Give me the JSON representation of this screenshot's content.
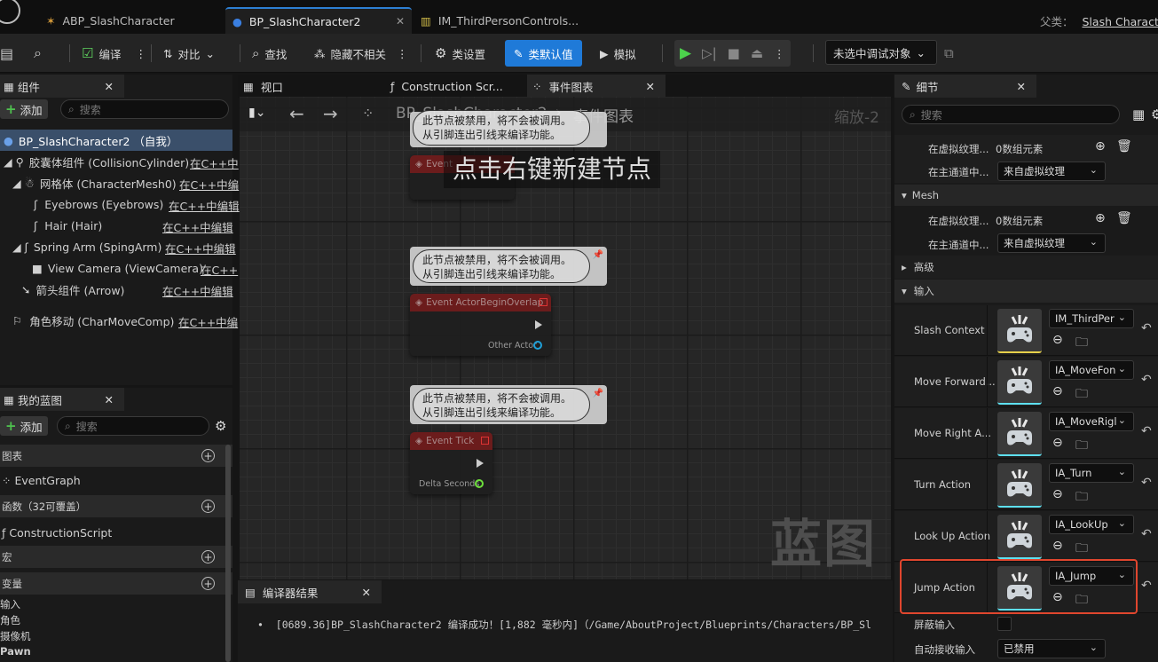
{
  "tabs": [
    {
      "label": "ABP_SlashCharacter",
      "icon": "anim-blueprint-icon"
    },
    {
      "label": "BP_SlashCharacter2",
      "icon": "character-blueprint-icon"
    },
    {
      "label": "IM_ThirdPersonControls...",
      "icon": "input-mapping-icon"
    }
  ],
  "parent_class": {
    "label": "父类：",
    "value": "Slash Character"
  },
  "toolbar": {
    "compile": "编译",
    "diff": "对比",
    "find": "查找",
    "hide_unrelated": "隐藏不相关",
    "class_settings": "类设置",
    "class_defaults": "类默认值",
    "simulate": "模拟",
    "debug_target": "未选中调试对象"
  },
  "components_panel": {
    "title": "组件",
    "add": "添加",
    "search_placeholder": "搜索",
    "root": "BP_SlashCharacter2 （自我）",
    "items": [
      {
        "label": "胶囊体组件 (CollisionCylinder)",
        "link": "在C++中"
      },
      {
        "label": "网格体 (CharacterMesh0)",
        "link": "在C++中编"
      },
      {
        "label": "Eyebrows (Eyebrows)",
        "link": "在C++中编辑"
      },
      {
        "label": "Hair (Hair)",
        "link": "在C++中编辑"
      },
      {
        "label": "Spring Arm (SpingArm)",
        "link": "在C++中编辑"
      },
      {
        "label": "View Camera (ViewCamera)",
        "link": "在C++"
      },
      {
        "label": "箭头组件 (Arrow)",
        "link": "在C++中编辑"
      },
      {
        "label": "角色移动 (CharMoveComp)",
        "link": "在C++中编"
      }
    ]
  },
  "my_blueprint": {
    "title": "我的蓝图",
    "add": "添加",
    "search_placeholder": "搜索",
    "graphs_header": "图表",
    "event_graph": "EventGraph",
    "functions_header": "函数（32可覆盖）",
    "construction_script": "ConstructionScript",
    "macros_header": "宏",
    "variables_header": "变量",
    "variable_categories": [
      "输入",
      "角色",
      "摄像机",
      "Pawn"
    ]
  },
  "graph_tabs": [
    {
      "label": "视口"
    },
    {
      "label": "Construction Scr..."
    },
    {
      "label": "事件图表"
    }
  ],
  "graph": {
    "breadcrumb_root": "BP_SlashCharacter2",
    "breadcrumb_current": "事件图表",
    "zoom": "缩放-2",
    "hint": "点击右键新建节点",
    "watermark": "蓝图",
    "disabled_comment": "此节点被禁用，将不会被调用。\n从引脚连出引线来编译功能。",
    "nodes": [
      {
        "title": "Event ActorBeginOverlap",
        "pin": "Other Actor"
      },
      {
        "title": "Event Tick",
        "pin": "Delta Seconds"
      },
      {
        "title": "Event",
        "pin": ""
      }
    ]
  },
  "compiler": {
    "title": "编译器结果",
    "message": "[0689.36]BP_SlashCharacter2 编译成功！[1,882 毫秒内]（/Game/AboutProject/Blueprints/Characters/BP_Sl"
  },
  "details": {
    "title": "细节",
    "search_placeholder": "搜索",
    "rows_top": [
      {
        "label": "在虚拟纹理...",
        "value": "0数组元素"
      },
      {
        "label": "在主通道中...",
        "value": "来自虚拟纹理"
      }
    ],
    "mesh_header": "Mesh",
    "rows_mesh": [
      {
        "label": "在虚拟纹理...",
        "value": "0数组元素"
      },
      {
        "label": "在主通道中...",
        "value": "来自虚拟纹理"
      }
    ],
    "advanced_header": "高级",
    "input_header": "输入",
    "input_rows": [
      {
        "label": "Slash Context",
        "value": "IM_ThirdPer"
      },
      {
        "label": "Move Forward...",
        "value": "IA_MoveFon"
      },
      {
        "label": "Move Right A...",
        "value": "IA_MoveRigl"
      },
      {
        "label": "Turn Action",
        "value": "IA_Turn"
      },
      {
        "label": "Look Up Action",
        "value": "IA_LookUp"
      },
      {
        "label": "Jump Action",
        "value": "IA_Jump"
      }
    ],
    "block_input": "屏蔽输入",
    "auto_receive_input": {
      "label": "自动接收输入",
      "value": "已禁用"
    },
    "highlight_color": "#e0462e"
  }
}
